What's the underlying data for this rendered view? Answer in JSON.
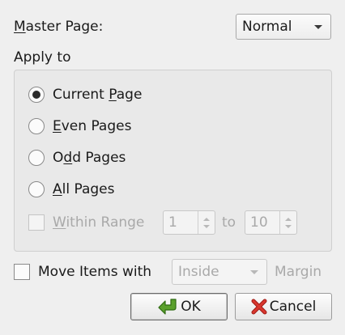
{
  "master_page": {
    "label_mnemonic": "M",
    "label_rest": "aster Page:",
    "selected": "Normal"
  },
  "apply_to": {
    "title": "Apply to",
    "options": [
      {
        "pre": "Current ",
        "mn": "P",
        "post": "age",
        "checked": true
      },
      {
        "pre": "",
        "mn": "E",
        "post": "ven Pages",
        "checked": false
      },
      {
        "pre": "O",
        "mn": "d",
        "post": "d Pages",
        "checked": false
      },
      {
        "pre": "",
        "mn": "A",
        "post": "ll Pages",
        "checked": false
      }
    ],
    "within_range": {
      "mn": "W",
      "post": "ithin Range",
      "checked": false,
      "from": "1",
      "to_label": "to",
      "to": "10"
    }
  },
  "move_items": {
    "label": "Move Items with",
    "selected": "Inside",
    "suffix": "Margin",
    "checked": false
  },
  "buttons": {
    "ok": "OK",
    "cancel": "Cancel"
  },
  "icons": {
    "ok": "green-arrow-icon",
    "cancel": "red-x-icon"
  }
}
